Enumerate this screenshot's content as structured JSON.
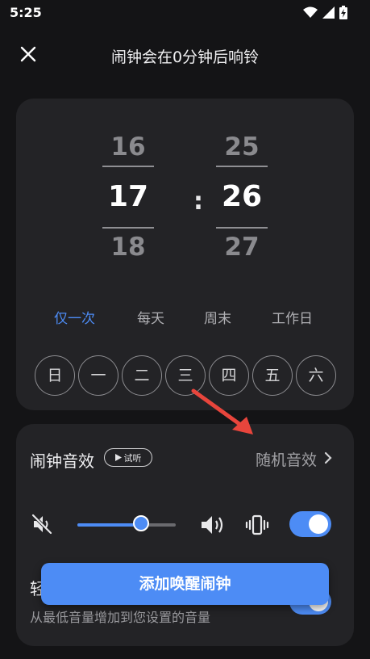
{
  "status_bar": {
    "time": "5:25"
  },
  "header": {
    "title": "闹钟会在0分钟后响铃"
  },
  "time_picker": {
    "hour": {
      "prev": "16",
      "current": "17",
      "next": "18"
    },
    "separator": ":",
    "minute": {
      "prev": "25",
      "current": "26",
      "next": "27"
    }
  },
  "repeat_options": [
    {
      "label": "仅一次",
      "active": true
    },
    {
      "label": "每天",
      "active": false
    },
    {
      "label": "周末",
      "active": false
    },
    {
      "label": "工作日",
      "active": false
    }
  ],
  "weekdays": [
    "日",
    "一",
    "二",
    "三",
    "四",
    "五",
    "六"
  ],
  "sound": {
    "label": "闹钟音效",
    "preview_label": "试听",
    "value": "随机音效",
    "volume_fraction": 0.65,
    "vibrate_enabled": true
  },
  "fade_in": {
    "title": "轻",
    "subtitle": "从最低音量增加到您设置的音量",
    "enabled": true
  },
  "add_button_label": "添加唤醒闹钟",
  "colors": {
    "accent": "#4d8cf5",
    "annotation_arrow": "#e8453c",
    "card_bg": "#232326",
    "page_bg": "#141416"
  }
}
